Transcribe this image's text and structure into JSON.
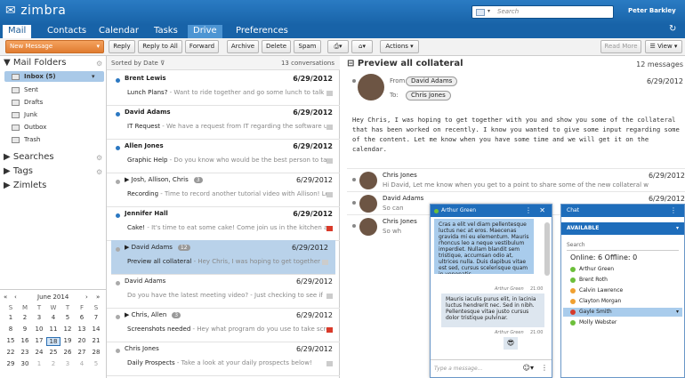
{
  "app": {
    "logo": "zimbra",
    "user": "Peter Barkley",
    "search_placeholder": "Search",
    "search_scope": "▾"
  },
  "tabs": [
    {
      "label": "Mail"
    },
    {
      "label": "Contacts"
    },
    {
      "label": "Calendar"
    },
    {
      "label": "Tasks"
    },
    {
      "label": "Drive"
    },
    {
      "label": "Preferences"
    }
  ],
  "toolbar": {
    "new_message": "New Message",
    "reply": "Reply",
    "reply_all": "Reply to All",
    "forward": "Forward",
    "archive": "Archive",
    "delete": "Delete",
    "spam": "Spam",
    "actions": "Actions",
    "read_more": "Read More",
    "view": "View"
  },
  "sidebar": {
    "mail_folders": "Mail Folders",
    "folders": [
      {
        "label": "Inbox (5)"
      },
      {
        "label": "Sent"
      },
      {
        "label": "Drafts"
      },
      {
        "label": "Junk"
      },
      {
        "label": "Outbox"
      },
      {
        "label": "Trash"
      }
    ],
    "searches": "Searches",
    "tags": "Tags",
    "zimlets": "Zimlets"
  },
  "calendar": {
    "month": "June 2014",
    "days": [
      "S",
      "M",
      "T",
      "W",
      "T",
      "F",
      "S"
    ],
    "weeks": [
      [
        "1",
        "2",
        "3",
        "4",
        "5",
        "6",
        "7"
      ],
      [
        "8",
        "9",
        "10",
        "11",
        "12",
        "13",
        "14"
      ],
      [
        "15",
        "16",
        "17",
        "18",
        "19",
        "20",
        "21"
      ],
      [
        "22",
        "23",
        "24",
        "25",
        "26",
        "27",
        "28"
      ],
      [
        "29",
        "30",
        "1",
        "2",
        "3",
        "4",
        "5"
      ]
    ],
    "today": "18"
  },
  "list": {
    "sort": "Sorted by Date",
    "count": "13 conversations",
    "rows": [
      {
        "from": "Brent Lewis",
        "date": "6/29/2012",
        "subject": "Lunch Plans?",
        "preview": " - Want to ride together and go some lunch to talk",
        "unread": true
      },
      {
        "from": "David Adams",
        "date": "6/29/2012",
        "subject": "IT Request",
        "preview": " - We have a request from IT regarding the software upda",
        "unread": true
      },
      {
        "from": "Allen Jones",
        "date": "6/29/2012",
        "subject": "Graphic Help",
        "preview": " - Do you know who would be the best person to talk t",
        "unread": true
      },
      {
        "from": "▶ Josh, Allison, Chris",
        "count": "3",
        "date": "6/29/2012",
        "subject": "Recording",
        "preview": " - Time to record another tutorial video with Allison! Let",
        "unread": false
      },
      {
        "from": "Jennifer Hall",
        "date": "6/29/2012",
        "subject": "Cake!",
        "preview": " - It's time to eat some cake! Come join us in the kitchen a",
        "unread": true
      },
      {
        "from": "▶ David Adams",
        "count": "12",
        "date": "6/29/2012",
        "subject": "Preview all collateral",
        "preview": " - Hey Chris, I was hoping to get together with you",
        "unread": false,
        "selected": true
      },
      {
        "from": "David Adams",
        "date": "6/29/2012",
        "subject": "",
        "preview": "Do you have the latest meeting video? - Just checking to see if",
        "unread": false
      },
      {
        "from": "▶ Chris, Allen",
        "count": "3",
        "date": "6/29/2012",
        "subject": "Screenshots needed",
        "preview": " - Hey what program do you use to take screensh",
        "unread": false
      },
      {
        "from": "Chris Jones",
        "date": "6/29/2012",
        "subject": "Daily Prospects",
        "preview": " - Take a look at your daily prospects below!",
        "unread": false
      }
    ]
  },
  "reading": {
    "title": "Preview all collateral",
    "count": "12 messages",
    "from_label": "From:",
    "to_label": "To:",
    "from": "David Adams",
    "to": "Chris Jones",
    "date": "6/29/2012",
    "body": "Hey Chris, I was hoping to get together with you and show you some of the collateral that has been worked on recently. I know you wanted to give some input regarding some of the content. Let me know when you have some time and we will get it on the calendar.",
    "convo": [
      {
        "from": "Chris Jones",
        "date": "6/29/2012",
        "preview": "Hi David, Let me know when you get to a point to share some of the new collateral w"
      },
      {
        "from": "David Adams",
        "date": "6/29/2012",
        "preview": "So can"
      },
      {
        "from": "Chris Jones",
        "date": "6/29/2012",
        "preview": "So wh"
      }
    ]
  },
  "chat_window": {
    "name": "Arthur Green",
    "msg1": "Cras a elit vel diam pellentesque luctus nec at eros. Maecenas gravida mi eu elementum. Mauris rhoncus leo a neque vestibulum imperdiet. Nullam blandit sem tristique, accumsan odio at, ultrices nulla. Duis dapibus vitae est sed, cursus scelerisque quam in venenatis.",
    "msg_sender": "Arthur Green",
    "msg_time": "21:00",
    "msg2": "Mauris iaculis purus elit, in lacinia luctus hendrerit nec. Sed in nibh. Pellentesque vitae justo cursus dolor tristique pulvinar.",
    "emoji": "😎",
    "placeholder": "Type a message..."
  },
  "chat_panel": {
    "title": "Chat",
    "status": "AVAILABLE",
    "search": "Search",
    "summary": "Online: 6 Offline: 0",
    "buddies": [
      {
        "name": "Arthur Green",
        "color": "#6cbf3a"
      },
      {
        "name": "Brent Roth",
        "color": "#6cbf3a"
      },
      {
        "name": "Calvin Lawrence",
        "color": "#f0a030"
      },
      {
        "name": "Clayton Morgan",
        "color": "#f0a030"
      },
      {
        "name": "Gayle Smith",
        "color": "#d63a2a",
        "selected": true
      },
      {
        "name": "Molly Webster",
        "color": "#6cbf3a"
      }
    ]
  }
}
